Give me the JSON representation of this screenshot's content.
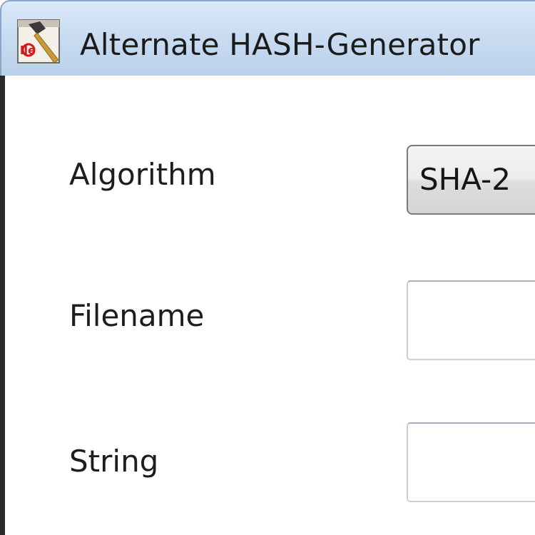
{
  "window": {
    "title": "Alternate HASH-Generator",
    "icon": "hash-generator-app-icon"
  },
  "form": {
    "algorithm_label": "Algorithm",
    "algorithm_value": "SHA-2",
    "filename_label": "Filename",
    "filename_value": "",
    "string_label": "String",
    "string_value": ""
  },
  "colors": {
    "titlebar": "#c9dcf1",
    "window_border": "#2b2b2b",
    "background": "#ffffff"
  }
}
